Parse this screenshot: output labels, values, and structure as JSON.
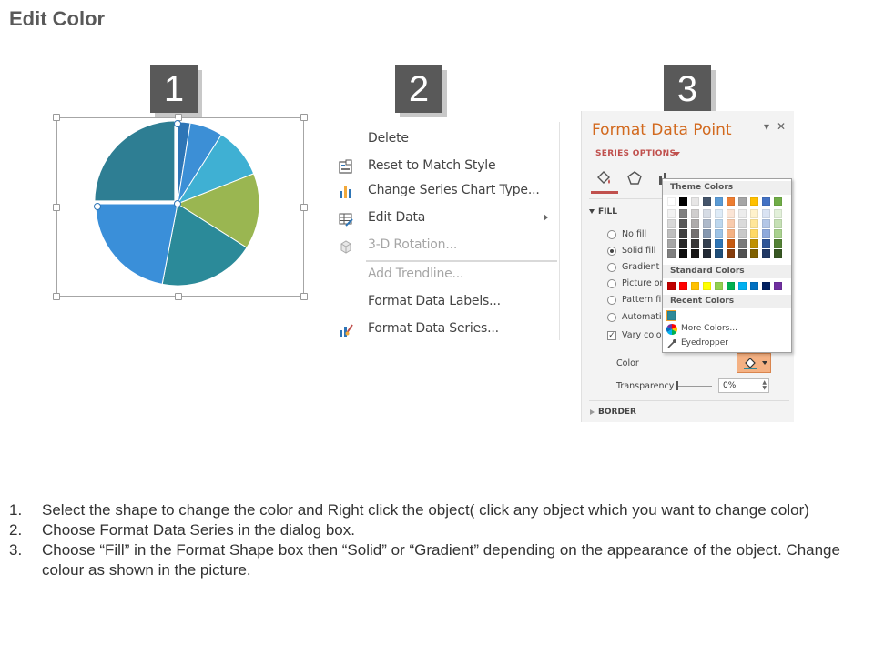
{
  "page": {
    "title": "Edit Color"
  },
  "steps": [
    {
      "number": "1"
    },
    {
      "number": "2"
    },
    {
      "number": "3"
    }
  ],
  "pie": {
    "slice_colors": [
      "#2e75b6",
      "#3c8fd6",
      "#3fb0d3",
      "#9ab651",
      "#2b8a99",
      "#3a8fd9",
      "#2e7e93"
    ],
    "slice_shares": [
      2.5,
      6.5,
      10,
      15,
      19,
      22,
      25
    ]
  },
  "context_menu": {
    "items": [
      {
        "label": "Delete",
        "icon": "",
        "disabled": false,
        "submenu": false
      },
      {
        "label": "Reset to Match Style",
        "icon": "reset-style-icon",
        "disabled": false,
        "submenu": false
      },
      {
        "label": "Change Series Chart Type...",
        "icon": "chart-type-icon",
        "disabled": false,
        "submenu": false
      },
      {
        "label": "Edit Data",
        "icon": "edit-data-icon",
        "disabled": false,
        "submenu": true
      },
      {
        "label": "3-D Rotation...",
        "icon": "rotation-3d-icon",
        "disabled": true,
        "submenu": false
      },
      {
        "label": "Add Trendline...",
        "icon": "",
        "disabled": true,
        "submenu": false
      },
      {
        "label": "Format Data Labels...",
        "icon": "",
        "disabled": false,
        "submenu": false
      },
      {
        "label": "Format Data Series...",
        "icon": "format-series-icon",
        "disabled": false,
        "submenu": false
      }
    ]
  },
  "format_pane": {
    "title": "Format Data Point",
    "close_symbol": "✕",
    "options_caret_symbol": "▾",
    "series_options": "SERIES OPTIONS",
    "fill_section": "FILL",
    "fill_options": [
      {
        "label": "No fill",
        "type": "radio",
        "selected": false
      },
      {
        "label": "Solid fill",
        "type": "radio",
        "selected": true
      },
      {
        "label": "Gradient fi",
        "type": "radio",
        "selected": false
      },
      {
        "label": "Picture or",
        "type": "radio",
        "selected": false
      },
      {
        "label": "Pattern fill",
        "type": "radio",
        "selected": false
      },
      {
        "label": "Automatic",
        "type": "radio",
        "selected": false
      },
      {
        "label": "Vary color",
        "type": "checkbox",
        "selected": true
      }
    ],
    "color_label": "Color",
    "transparency_label": "Transparency",
    "transparency_value": "0%",
    "border_section": "BORDER",
    "accent_color": "#c0504d"
  },
  "color_picker": {
    "theme_header": "Theme Colors",
    "standard_header": "Standard Colors",
    "recent_header": "Recent Colors",
    "more_colors": "More Colors...",
    "eyedropper": "Eyedropper",
    "theme_top": [
      "#ffffff",
      "#000000",
      "#e7e6e6",
      "#44546a",
      "#5b9bd5",
      "#ed7d31",
      "#a5a5a5",
      "#ffc000",
      "#4472c4",
      "#70ad47"
    ],
    "theme_shades": [
      [
        "#f2f2f2",
        "#808080",
        "#d0cece",
        "#d6dce5",
        "#deebf7",
        "#fbe5d6",
        "#ededed",
        "#fff2cc",
        "#dae3f3",
        "#e2f0d9"
      ],
      [
        "#d9d9d9",
        "#595959",
        "#aeabab",
        "#adb9ca",
        "#bdd7ee",
        "#f8cbad",
        "#dbdbdb",
        "#ffe699",
        "#b4c7e7",
        "#c5e0b4"
      ],
      [
        "#bfbfbf",
        "#404040",
        "#757171",
        "#8497b0",
        "#9dc3e6",
        "#f4b183",
        "#c9c9c9",
        "#ffd966",
        "#8faadc",
        "#a9d18e"
      ],
      [
        "#a6a6a6",
        "#262626",
        "#3a3838",
        "#333f50",
        "#2e75b6",
        "#c55a11",
        "#7b7b7b",
        "#bf9000",
        "#2f5597",
        "#548235"
      ],
      [
        "#7f7f7f",
        "#0d0d0d",
        "#171616",
        "#222a35",
        "#1f4e79",
        "#843c0c",
        "#525252",
        "#7f6000",
        "#203864",
        "#385723"
      ]
    ],
    "standard": [
      "#c00000",
      "#ff0000",
      "#ffc000",
      "#ffff00",
      "#92d050",
      "#00b050",
      "#00b0f0",
      "#0070c0",
      "#002060",
      "#7030a0"
    ],
    "recent": [
      "#2e8a99"
    ]
  },
  "instructions": [
    {
      "num": "1.",
      "text": "Select the shape to change the color and Right click the object( click any object which you want to change color)"
    },
    {
      "num": "2.",
      "text": "Choose Format Data Series in the dialog box."
    },
    {
      "num": "3.",
      "text": "Choose “Fill” in the Format Shape box then “Solid” or “Gradient” depending on the appearance of the object. Change colour as shown in the picture."
    }
  ]
}
